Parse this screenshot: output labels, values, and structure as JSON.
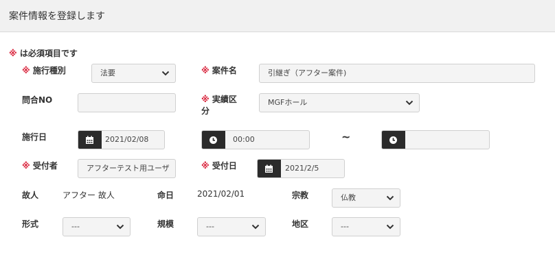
{
  "header": {
    "title": "案件情報を登録します"
  },
  "required_note": {
    "mark": "※",
    "text": "は必須項目です"
  },
  "labels": {
    "sekou_shubetsu": "施行種別",
    "anken_mei": "案件名",
    "toigo_no": "問合NO",
    "jisseki_ku": "実績区分",
    "sekou_bi": "施行日",
    "uketsukesha": "受付者",
    "uketsuke_bi": "受付日",
    "kojin": "故人",
    "meinichi": "命日",
    "shukyo": "宗教",
    "keishiki": "形式",
    "kibo": "規模",
    "chiku": "地区"
  },
  "required_mark": "※",
  "fields": {
    "sekou_shubetsu": "法要",
    "anken_mei": "引継ぎ（アフター案件)",
    "toigo_no": "",
    "jisseki_ku": "MGFホール",
    "sekou_bi_date": "2021/02/08",
    "time_start": "00:00",
    "time_end": "",
    "uketsukesha": "アフターテスト用ユーザ",
    "uketsuke_bi": "2021/2/5",
    "shukyo": "仏教",
    "keishiki": "---",
    "kibo": "---",
    "chiku": "---"
  },
  "values": {
    "kojin": "アフター 故人",
    "meinichi": "2021/02/01"
  },
  "tilde": "~",
  "icons": {
    "calendar": "calendar-icon",
    "clock": "clock-icon",
    "chevron": "chevron-down-icon"
  },
  "colors": {
    "required": "#d9243c",
    "addon": "#2b2b2b",
    "field_bg": "#f4f4f4",
    "header_bg": "#f1f1f1"
  }
}
